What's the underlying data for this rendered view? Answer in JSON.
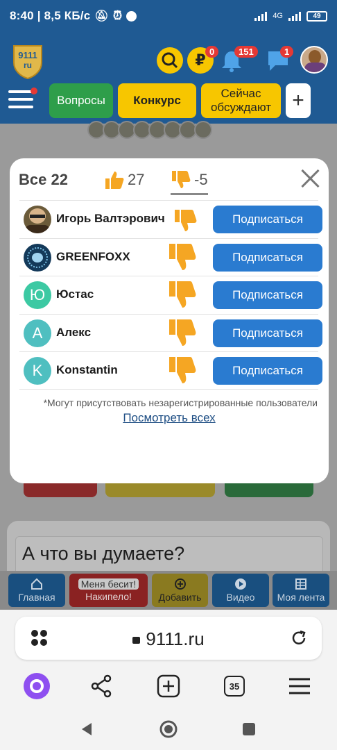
{
  "status_bar": {
    "time_speed": "8:40 | 8,5 КБ/с",
    "network": "4G",
    "battery": "49"
  },
  "header": {
    "logo_text_top": "9111",
    "logo_text_bottom": "ru",
    "currency_badge": "0",
    "notifications_badge": "151",
    "messages_badge": "1",
    "currency_symbol": "₽"
  },
  "nav": {
    "questions": "Вопросы",
    "contest": "Конкурс",
    "discussing": "Сейчас обсуждают",
    "add": "+"
  },
  "modal": {
    "all_label": "Все 22",
    "likes_count": "27",
    "dislikes_count": "-5",
    "users": [
      {
        "name": "Игорь Валтэрович",
        "initial": "",
        "subscribe": "Подписаться"
      },
      {
        "name": "GREENFOXX",
        "initial": "",
        "subscribe": "Подписаться"
      },
      {
        "name": "Юстас",
        "initial": "Ю",
        "subscribe": "Подписаться"
      },
      {
        "name": "Алекс",
        "initial": "А",
        "subscribe": "Подписаться"
      },
      {
        "name": "Konstantin",
        "initial": "K",
        "subscribe": "Подписаться"
      }
    ],
    "note": "*Могут присутствовать незарегистрированные пользователи",
    "view_all": "Посмотреть всех"
  },
  "background_page": {
    "question_placeholder": "А что вы думаете?"
  },
  "bottom_nav": {
    "home": "Главная",
    "annoys_top": "Меня бесит!",
    "annoys_bottom": "Накипело!",
    "add": "Добавить",
    "video": "Видео",
    "feed": "Моя лента"
  },
  "browser": {
    "url": "9111.ru",
    "tabs_count": "35"
  },
  "colors": {
    "brand_blue": "#1f5a93",
    "subscribe_blue": "#2a7bd0",
    "thumb_orange": "#f5a623",
    "contest_yellow": "#f7c600",
    "questions_green": "#2e9e4a"
  }
}
